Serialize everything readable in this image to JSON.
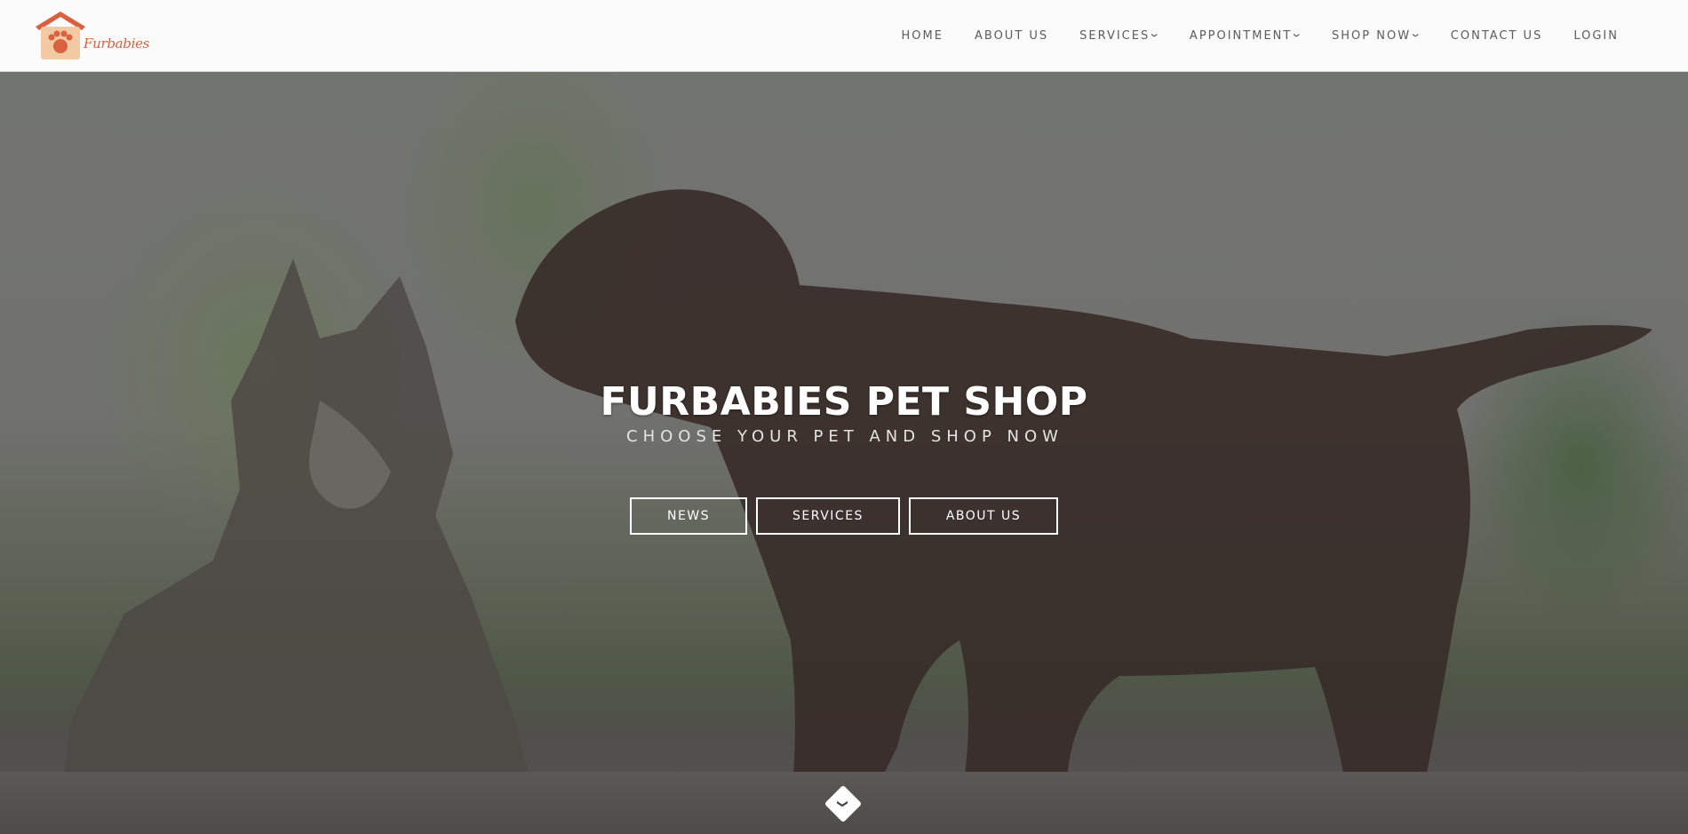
{
  "brand": {
    "logo_text": "Furbabies",
    "colors": {
      "primary": "#d9613f",
      "house": "#f2c9a2"
    }
  },
  "nav": {
    "items": [
      {
        "label": "HOME",
        "has_dropdown": false
      },
      {
        "label": "ABOUT US",
        "has_dropdown": false
      },
      {
        "label": "SERVICES",
        "has_dropdown": true
      },
      {
        "label": "APPOINTMENT",
        "has_dropdown": true
      },
      {
        "label": "SHOP NOW",
        "has_dropdown": true
      },
      {
        "label": "CONTACT US",
        "has_dropdown": false
      },
      {
        "label": "LOGIN",
        "has_dropdown": false
      }
    ],
    "caret_icon": "chevron-down-icon"
  },
  "hero": {
    "title": "FURBABIES PET SHOP",
    "subtitle": "CHOOSE YOUR PET AND SHOP NOW",
    "buttons": [
      {
        "label": "NEWS"
      },
      {
        "label": "SERVICES"
      },
      {
        "label": "ABOUT US"
      }
    ],
    "scroll_icon": "chevron-down-icon"
  }
}
